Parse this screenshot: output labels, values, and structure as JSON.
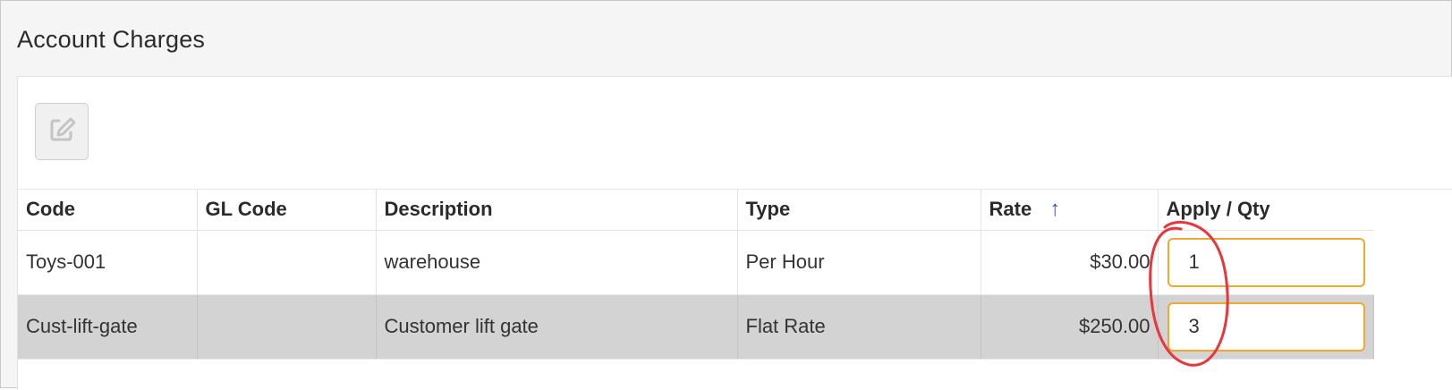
{
  "panel": {
    "title": "Account Charges"
  },
  "toolbar": {
    "edit_icon": "edit-icon"
  },
  "table": {
    "columns": [
      "Code",
      "GL Code",
      "Description",
      "Type",
      "Rate",
      "Apply / Qty"
    ],
    "sort_indicator": "↑",
    "rows": [
      {
        "code": "Toys-001",
        "gl_code": "",
        "description": "warehouse",
        "type": "Per Hour",
        "rate": "$30.00",
        "qty": "1"
      },
      {
        "code": "Cust-lift-gate",
        "gl_code": "",
        "description": "Customer lift gate",
        "type": "Flat Rate",
        "rate": "$250.00",
        "qty": "3"
      }
    ]
  },
  "colors": {
    "input_border": "#f0a832",
    "selected_row": "#d3d3d3",
    "annotation": "#e8363c",
    "sort_arrow": "#2f5ea8"
  }
}
